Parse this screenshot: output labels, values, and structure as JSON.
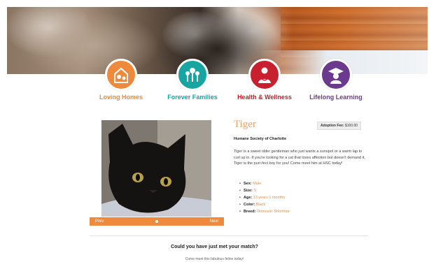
{
  "categories": [
    {
      "label": "Loving Homes",
      "color": "#ef8a3c",
      "icon": "home-pets-icon"
    },
    {
      "label": "Forever Families",
      "color": "#16a5a0",
      "icon": "family-tree-icon"
    },
    {
      "label": "Health & Wellness",
      "color": "#c8202e",
      "icon": "doctor-icon"
    },
    {
      "label": "Lifelong Learning",
      "color": "#6b3a8e",
      "icon": "graduate-icon"
    }
  ],
  "pet": {
    "name": "Tiger",
    "adoption_fee_label": "Adoption Fee:",
    "adoption_fee_value": "$100.00",
    "organization": "Humane Society of Charlotte",
    "description": "Tiger is a sweet older gentleman who just wants a sunspot or a warm lap to curl up in. If you're looking for a cat that loves affection but doesn't demand it, Tiger is the purr-fect boy for you! Come meet him at HSC today!",
    "facts": [
      {
        "key": "Sex:",
        "value": "Male"
      },
      {
        "key": "Size:",
        "value": "S"
      },
      {
        "key": "Age:",
        "value": "13 years 1 months"
      },
      {
        "key": "Color:",
        "value": "Black"
      },
      {
        "key": "Breed:",
        "value": "Domestic Shorthair"
      }
    ]
  },
  "gallery": {
    "prev_label": "Prev",
    "next_label": "Next"
  },
  "footer": {
    "headline": "Could you have just met your match?",
    "subline": "Come meet this fabulous feline today!"
  }
}
